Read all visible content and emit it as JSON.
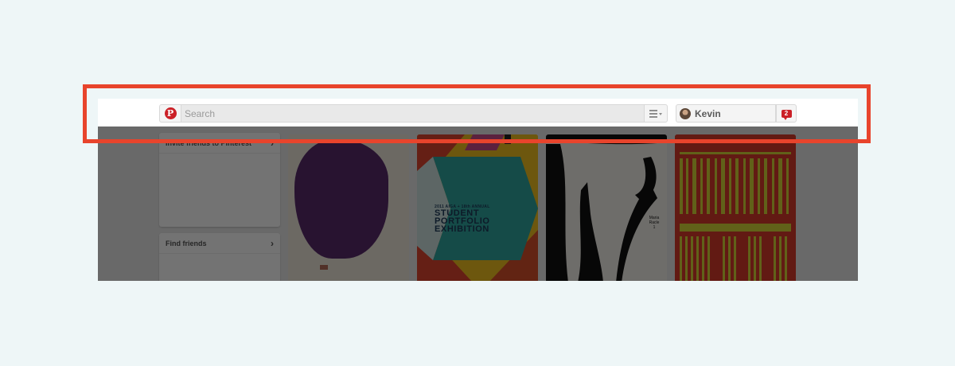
{
  "header": {
    "logo_icon": "pinterest-logo-icon",
    "logo_glyph": "P",
    "search_placeholder": "Search",
    "menu_icon": "list-menu-icon",
    "user_name": "Kevin",
    "notification_count": "2"
  },
  "sidebar": {
    "cards": [
      {
        "label": "Invite friends to Pinterest",
        "icon": "chevron-right-icon",
        "chevron": "›"
      },
      {
        "label": "Find friends",
        "icon": "chevron-right-icon",
        "chevron": "›"
      }
    ]
  },
  "pins": [
    {
      "name": "purple-painting-pin"
    },
    {
      "name": "student-portfolio-poster-pin",
      "line1": "2011 AIGA + 18th ANNUAL",
      "line2": "STUDENT",
      "line3": "PORTFOLIO",
      "line4": "EXHIBITION"
    },
    {
      "name": "hands-illustration-pin",
      "caption": "Maria\nRacle\n1"
    },
    {
      "name": "red-yellow-typography-pin"
    }
  ],
  "colors": {
    "accent_red": "#cb2027",
    "highlight_border": "#e8442c",
    "page_background": "#eef6f7"
  }
}
